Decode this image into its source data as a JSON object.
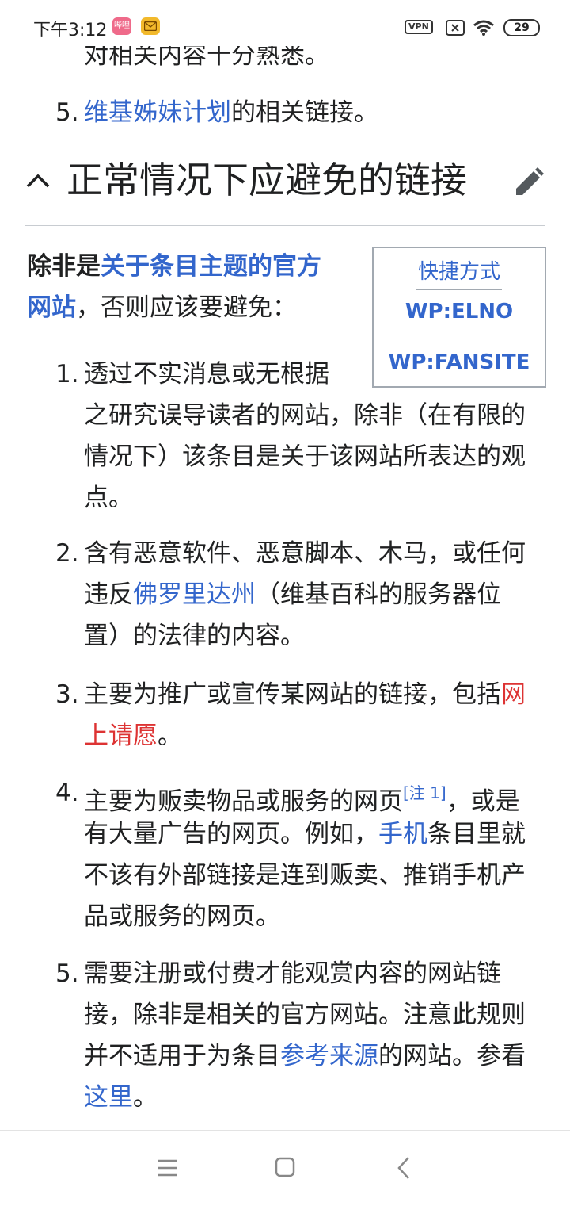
{
  "status_bar": {
    "time": "下午3:12",
    "app_icon_1": "哔哩",
    "vpn_label": "VPN",
    "battery": "29"
  },
  "article": {
    "prev_item_tail": "对相关内容十分熟悉。",
    "prev_item5_number": "5.",
    "prev_item5_link": "维基姊妹计划",
    "prev_item5_rest": "的相关链接。",
    "section_title": "正常情况下应避免的链接",
    "intro_bold": "除非是",
    "intro_link_line1": "关于条目主题的官方",
    "intro_link_line2": "网站",
    "intro_rest": "，否则应该要避免：",
    "items": [
      {
        "number": "1.",
        "lines": [
          "透过不实消息或无根据",
          "之研究误导读者的网站，除非（在有限的",
          "情况下）该条目是关于该网站所表达的观",
          "点。"
        ]
      },
      {
        "number": "2.",
        "line1": "含有恶意软件、恶意脚本、木马，或任何",
        "line2_pre": "违反",
        "line2_link": "佛罗里达州",
        "line2_post": "（维基百科的服务器位",
        "line3": "置）的法律的内容。"
      },
      {
        "number": "3.",
        "line1_pre": "主要为推广或宣传某网站的链接，包括",
        "line1_red": "网",
        "line2_red": "上请愿",
        "line2_post": "。"
      },
      {
        "number": "4.",
        "line1_pre": "主要为贩卖物品或服务的网页",
        "note": "[注 1]",
        "line1_post": "，或是",
        "line2_pre": "有大量广告的网页。例如，",
        "line2_link": "手机",
        "line2_post": "条目里就",
        "line3": "不该有外部链接是连到贩卖、推销手机产",
        "line4": "品或服务的网页。"
      },
      {
        "number": "5.",
        "line1": "需要注册或付费才能观赏内容的网站链",
        "line2": "接，除非是相关的官方网站。注意此规则",
        "line3_pre": "并不适用于为条目",
        "line3_link": "参考来源",
        "line3_post": "的网站。参看",
        "line4_link": "这里",
        "line4_post": "。"
      }
    ]
  },
  "shortcut_box": {
    "title": "快捷方式",
    "items": [
      "WP:ELNO",
      "WP:FANSITE"
    ]
  },
  "icons": {
    "chevron": "chevron-up-icon",
    "edit": "pencil-edit-icon",
    "menu": "menu-icon",
    "home": "home-square-icon",
    "back": "back-chevron-icon"
  },
  "colors": {
    "link": "#3366cc",
    "red_link": "#dd3333",
    "text": "#202122"
  }
}
